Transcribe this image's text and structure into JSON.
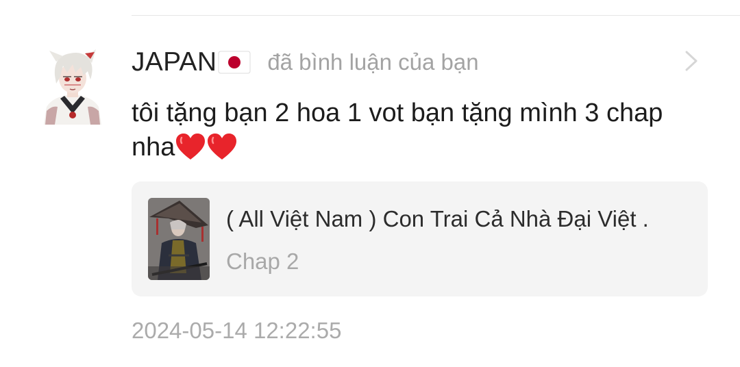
{
  "notification": {
    "user": {
      "name": "JAPAN",
      "flag_icon": "japan-flag-icon",
      "avatar_icon": "anime-character-avatar"
    },
    "action_text": "đã bình luận của bạn",
    "comment_text": "tôi tặng bạn 2 hoa 1 vot bạn tặng mình 3 chap nha",
    "comment_emoji": [
      "red-heart-icon",
      "red-heart-icon"
    ],
    "story": {
      "title": "( All Việt Nam ) Con Trai Cả Nhà Đại Việt .",
      "chapter": "Chap 2",
      "cover_icon": "story-cover-image"
    },
    "timestamp": "2024-05-14 12:22:55",
    "chevron_icon": "chevron-right-icon"
  },
  "colors": {
    "username": "#222222",
    "secondary_text": "#a3a3a3",
    "comment_text": "#1c1c1c",
    "card_background": "#f4f4f4",
    "heart": "#e8242b",
    "flag_red": "#bc002d"
  }
}
